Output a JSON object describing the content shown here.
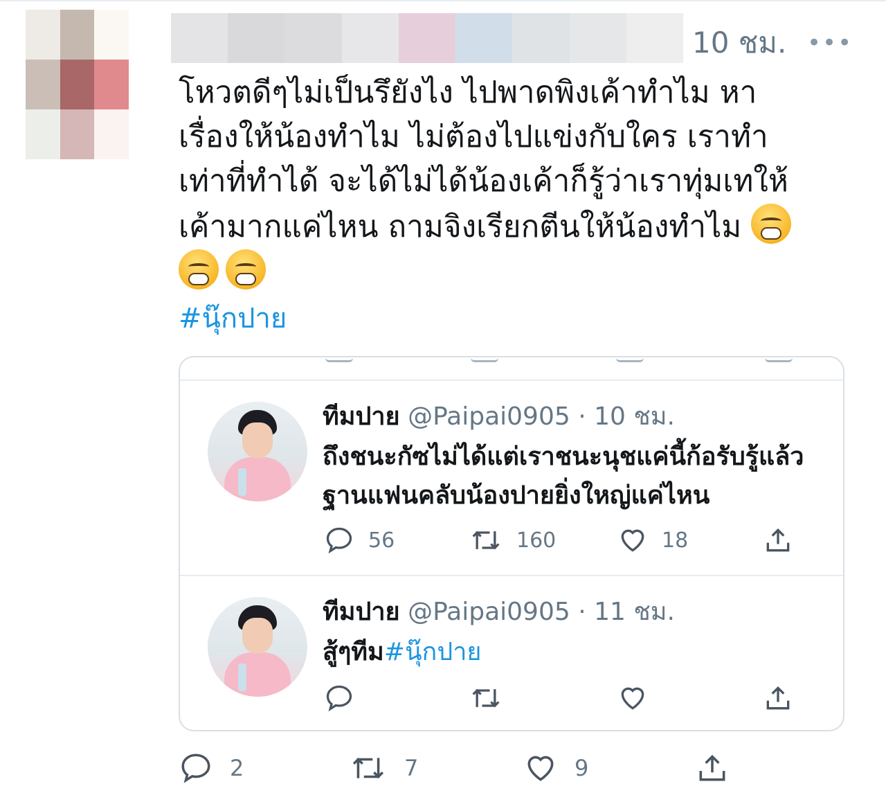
{
  "post": {
    "time": "10 ชม.",
    "more_icon": "•••",
    "text_lines": [
      "โหวตดีๆไม่เป็นรึยังไง ไปพาดพิงเค้าทำไม หา",
      "เรื่องให้น้องทำไม ไม่ต้องไปแข่งกับใคร เราทำ",
      "เท่าที่ทำได้ จะได้ไม่ได้น้องเค้าก็รู้ว่าเราทุ่มเทให้",
      "เค้ามากแค่ไหน ถามจิงเรียกตีนให้น้องทำไม"
    ],
    "emoji_icon": "face-with-steam-from-nose",
    "hashtag": "#นุ๊กปาย",
    "actions": {
      "reply_count": "2",
      "retweet_count": "7",
      "like_count": "9"
    }
  },
  "quoted": [
    {
      "name": "ทีมปาย",
      "handle": "@Paipai0905",
      "time": "· 10 ชม.",
      "line1": "ถึงชนะกัซไม่ได้แต่เราชนะนุชแค่นี้ก้อรับรู้แล้ว",
      "line2": "ฐานแฟนคลับน้องปายยิ่งใหญ่แค่ไหน",
      "reply_count": "56",
      "retweet_count": "160",
      "like_count": "18"
    },
    {
      "name": "ทีมปาย",
      "handle": "@Paipai0905",
      "time": "· 11 ชม.",
      "text": "สู้ๆทีม",
      "hashtag": "#นุ๊กปาย"
    }
  ],
  "colors": {
    "link": "#1b95e0",
    "muted": "#657786",
    "border": "#d9dfe4"
  }
}
